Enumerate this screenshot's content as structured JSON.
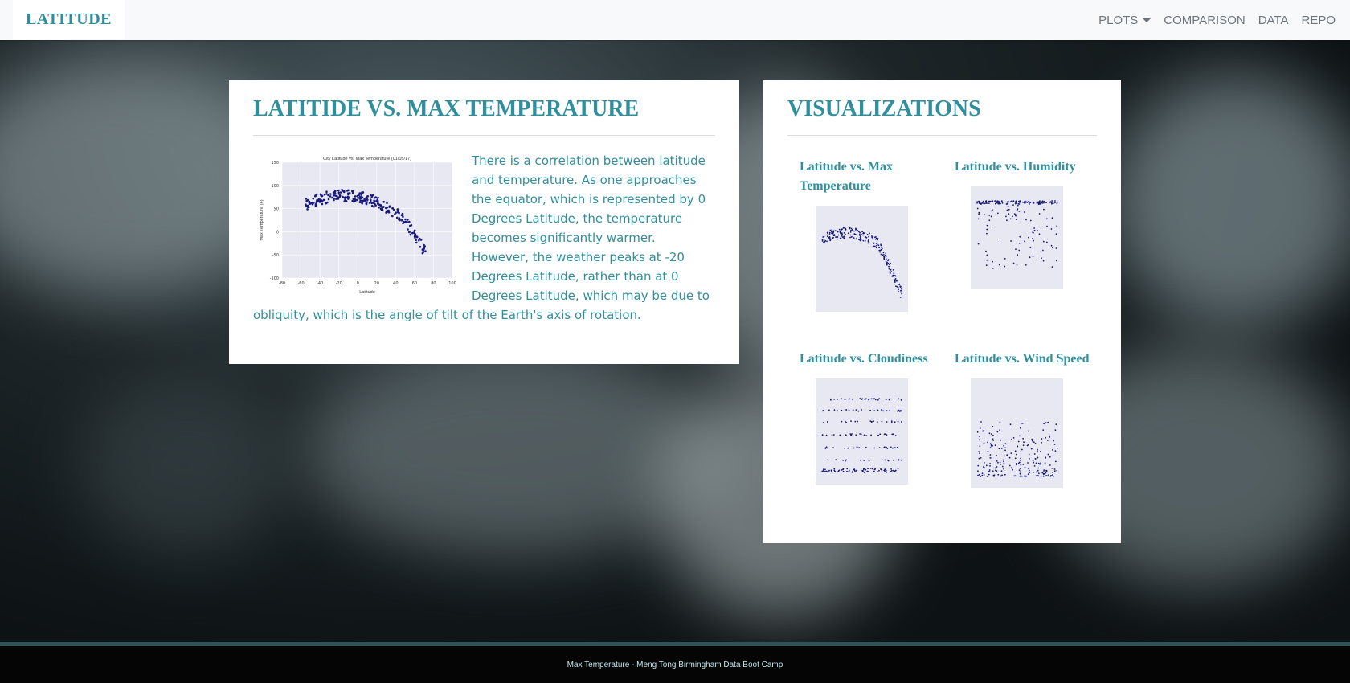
{
  "navbar": {
    "brand": "LATITUDE",
    "links": [
      "PLOTS",
      "COMPARISON",
      "DATA",
      "REPO"
    ]
  },
  "main": {
    "title": "LATITIDE VS. MAX TEMPERATURE",
    "description": "There is a correlation between latitude and temperature. As one approaches the equator, which is represented by 0 Degrees Latitude, the temperature becomes significantly warmer. However, the weather peaks at -20 Degrees Latitude, rather than at 0 Degrees Latitude, which may be due to obliquity, which is the angle of tilt of the Earth's axis of rotation.",
    "plot": {
      "title": "City Latitude vs. Max Temperature (01/05/17)",
      "xlabel": "Latitude",
      "ylabel": "Max Temperature (F)",
      "xticks": [
        "-80",
        "-60",
        "-40",
        "-20",
        "0",
        "20",
        "40",
        "60",
        "80",
        "100"
      ],
      "yticks": [
        "150",
        "100",
        "50",
        "0",
        "-50",
        "-100"
      ]
    }
  },
  "sidebar": {
    "title": "VISUALIZATIONS",
    "items": [
      {
        "label": "Latitude vs. Max Temperature"
      },
      {
        "label": "Latitude vs. Humidity"
      },
      {
        "label": "Latitude vs. Cloudiness"
      },
      {
        "label": "Latitude vs. Wind Speed"
      }
    ]
  },
  "footer": {
    "text": "Max Temperature - Meng Tong Birmingham Data Boot Camp"
  },
  "colors": {
    "accent": "#2f8f9d",
    "point": "#1a1a7a",
    "plot_bg": "#e8e8f2"
  }
}
